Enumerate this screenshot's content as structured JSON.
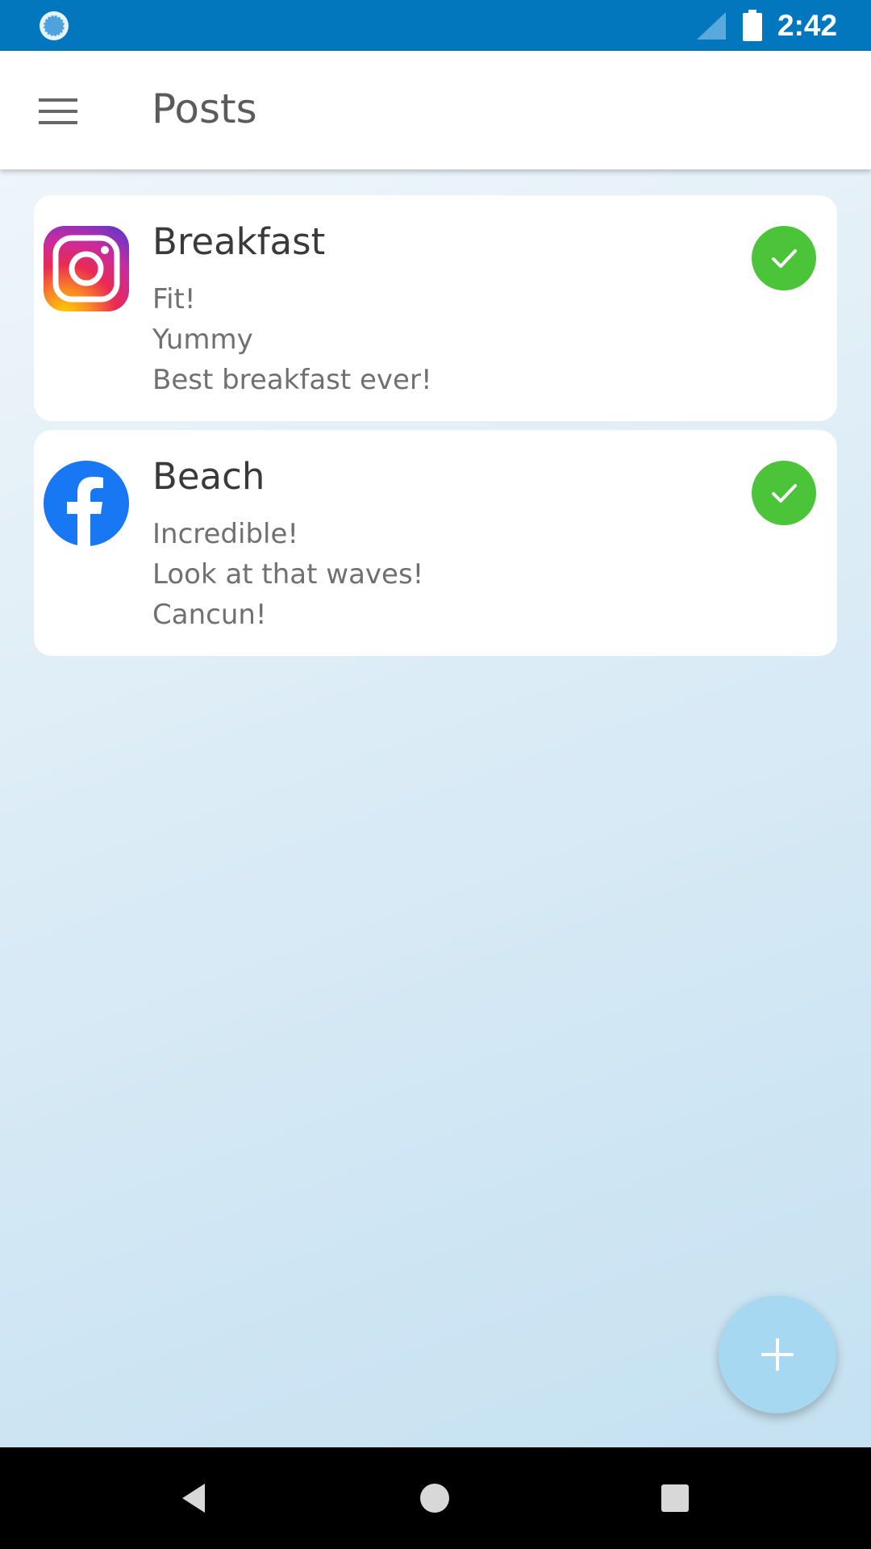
{
  "status_bar": {
    "time": "2:42",
    "icons": [
      "sync-icon",
      "signal-icon",
      "battery-icon"
    ],
    "background": "#0277bd"
  },
  "app_bar": {
    "title": "Posts",
    "menu_icon": "hamburger-menu-icon"
  },
  "posts": [
    {
      "platform": "instagram",
      "icon": "instagram-icon",
      "title": "Breakfast",
      "lines": [
        "Fit!",
        "Yummy",
        "Best breakfast ever!"
      ],
      "status": "published",
      "status_icon": "check-circle-icon"
    },
    {
      "platform": "facebook",
      "icon": "facebook-icon",
      "title": "Beach",
      "lines": [
        "Incredible!",
        "Look at that waves!",
        "Cancun!"
      ],
      "status": "published",
      "status_icon": "check-circle-icon"
    }
  ],
  "fab": {
    "icon": "plus-icon",
    "color": "#a6d9f1"
  },
  "colors": {
    "status_ok": "#4cc43a",
    "facebook_blue": "#1877f2",
    "accent": "#0277bd"
  },
  "nav_bar": {
    "icons": [
      "back-icon",
      "home-icon",
      "recents-icon"
    ]
  }
}
